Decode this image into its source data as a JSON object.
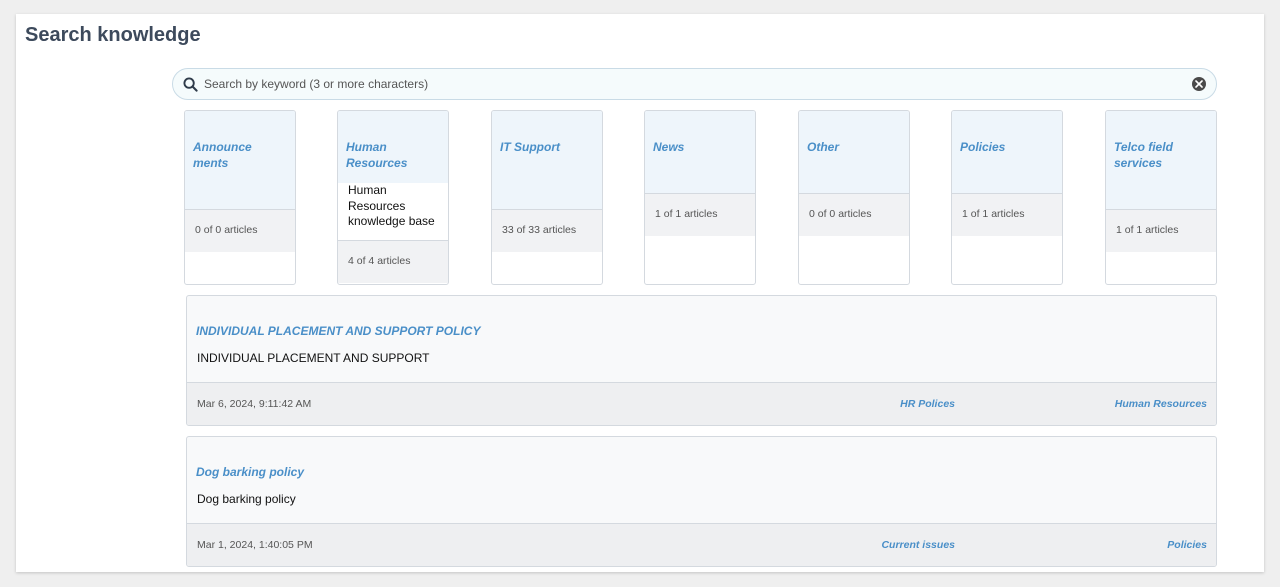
{
  "page": {
    "title": "Search knowledge"
  },
  "search": {
    "placeholder": "Search by keyword (3 or more characters)",
    "value": ""
  },
  "categories": [
    {
      "name": "Announce ments",
      "description": "",
      "count": "0 of 0 articles"
    },
    {
      "name": "Human Resources",
      "description": "Human Resources knowledge base",
      "count": "4 of 4 articles"
    },
    {
      "name": "IT Support",
      "description": "",
      "count": "33 of 33 articles"
    },
    {
      "name": "News",
      "description": "",
      "count": "1 of 1 articles"
    },
    {
      "name": "Other",
      "description": "",
      "count": "0 of 0 articles"
    },
    {
      "name": "Policies",
      "description": "",
      "count": "1 of 1 articles"
    },
    {
      "name": "Telco field services",
      "description": "",
      "count": "1 of 1 articles"
    }
  ],
  "articles": [
    {
      "title": "INDIVIDUAL PLACEMENT AND SUPPORT POLICY",
      "snippet": "INDIVIDUAL PLACEMENT AND SUPPORT",
      "date": "Mar 6, 2024, 9:11:42 AM",
      "knowledge_base": "HR Polices",
      "category": "Human Resources"
    },
    {
      "title": "Dog barking policy",
      "snippet": "Dog barking policy",
      "date": "Mar 1, 2024, 1:40:05 PM",
      "knowledge_base": "Current issues",
      "category": "Policies"
    }
  ],
  "colors": {
    "accent": "#4a8fc8",
    "title": "#3d4a5c",
    "header_bg": "#eef5fb"
  }
}
